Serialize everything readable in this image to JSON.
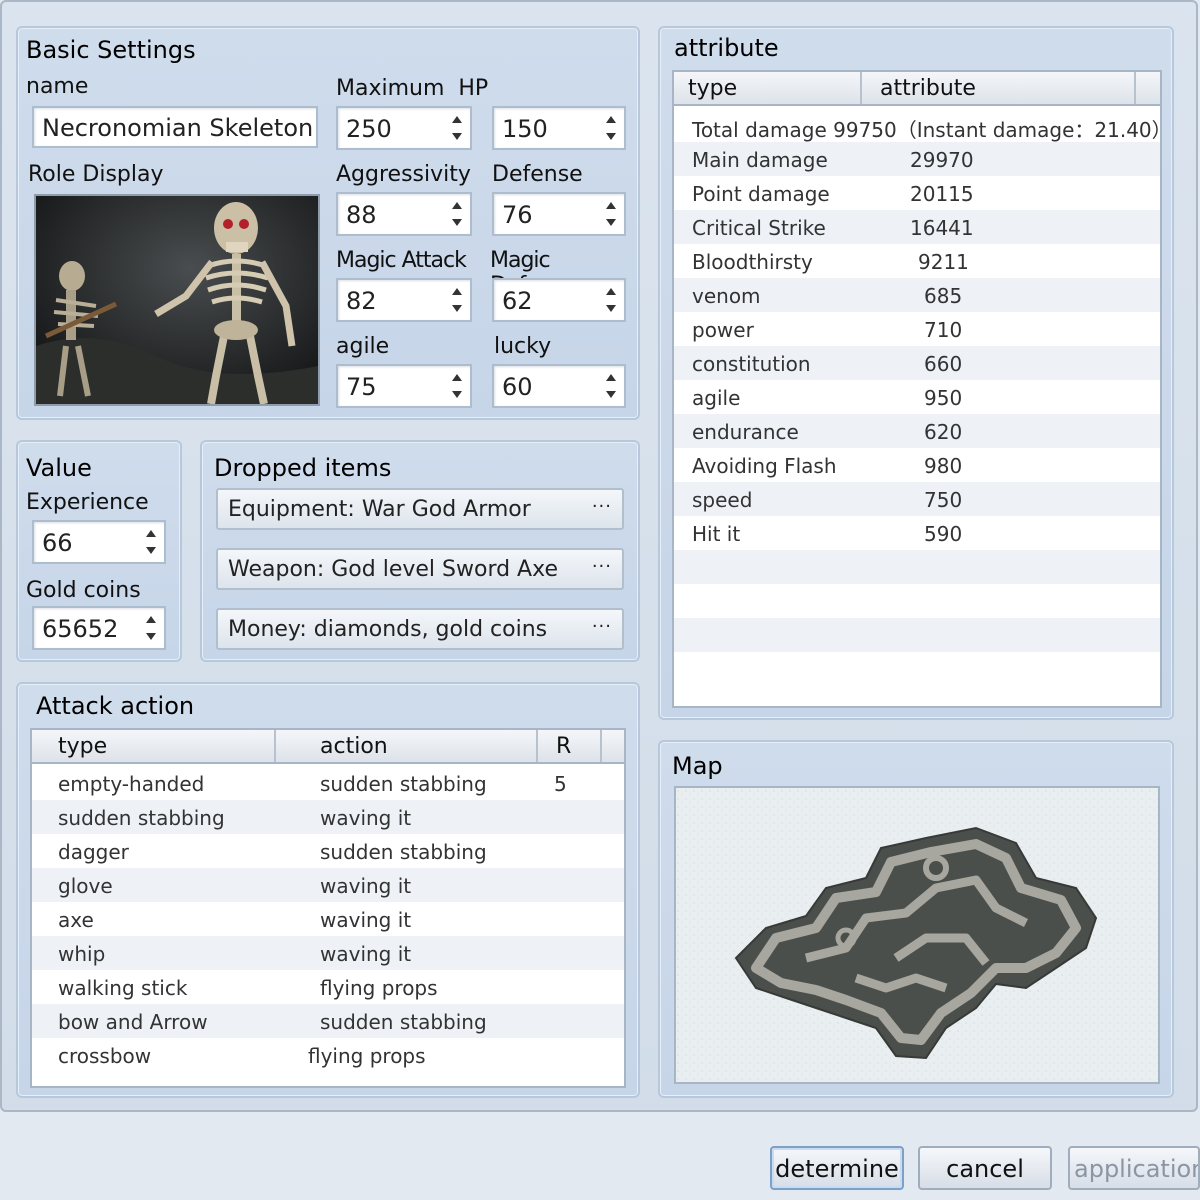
{
  "basic": {
    "title": "Basic Settings",
    "name_label": "name",
    "name_value": "Necronomian Skeleton",
    "role_label": "Role Display",
    "maxhp_label": "Maximum  HP",
    "maxhp_value": "250",
    "hp_value": "150",
    "aggr_label": "Aggressivity",
    "aggr_value": "88",
    "def_label": "Defense",
    "def_value": "76",
    "matk_label": "Magic Attack",
    "matk_value": "82",
    "mdef_label": "Magic Defense",
    "mdef_value": "62",
    "agile_label": "agile",
    "agile_value": "75",
    "lucky_label": "lucky",
    "lucky_value": "60"
  },
  "value": {
    "title": "Value",
    "exp_label": "Experience",
    "exp_value": "66",
    "gold_label": "Gold coins",
    "gold_value": "65652"
  },
  "dropped": {
    "title": "Dropped items",
    "items": [
      "Equipment: War God Armor",
      "Weapon: God level Sword Axe",
      "Money: diamonds, gold coins"
    ],
    "more": "···"
  },
  "attack": {
    "title": "Attack action",
    "headers": [
      "type",
      "action",
      "R"
    ],
    "rows": [
      [
        "empty-handed",
        "sudden stabbing",
        "5"
      ],
      [
        "sudden stabbing",
        "waving it",
        ""
      ],
      [
        "dagger",
        "sudden stabbing",
        ""
      ],
      [
        "glove",
        "waving it",
        ""
      ],
      [
        "axe",
        "waving it",
        ""
      ],
      [
        "whip",
        "waving it",
        ""
      ],
      [
        "walking stick",
        "flying props",
        ""
      ],
      [
        "bow and Arrow",
        "sudden stabbing",
        ""
      ],
      [
        "crossbow",
        "flying props",
        ""
      ]
    ]
  },
  "attribute": {
    "title": "attribute",
    "headers": [
      "type",
      "attribute"
    ],
    "total": "Total damage  99750（Instant damage：21.40）",
    "rows": [
      [
        "Main damage",
        "29970"
      ],
      [
        "Point damage",
        "20115"
      ],
      [
        "Critical Strike",
        "16441"
      ],
      [
        "Bloodthirsty",
        "9211"
      ],
      [
        "venom",
        "685"
      ],
      [
        "power",
        "710"
      ],
      [
        "constitution",
        "660"
      ],
      [
        "agile",
        "950"
      ],
      [
        "endurance",
        "620"
      ],
      [
        "Avoiding Flash",
        "980"
      ],
      [
        "speed",
        "750"
      ],
      [
        "Hit it",
        "590"
      ]
    ]
  },
  "map": {
    "title": "Map"
  },
  "buttons": {
    "determine": "determine",
    "cancel": "cancel",
    "application": "application"
  }
}
